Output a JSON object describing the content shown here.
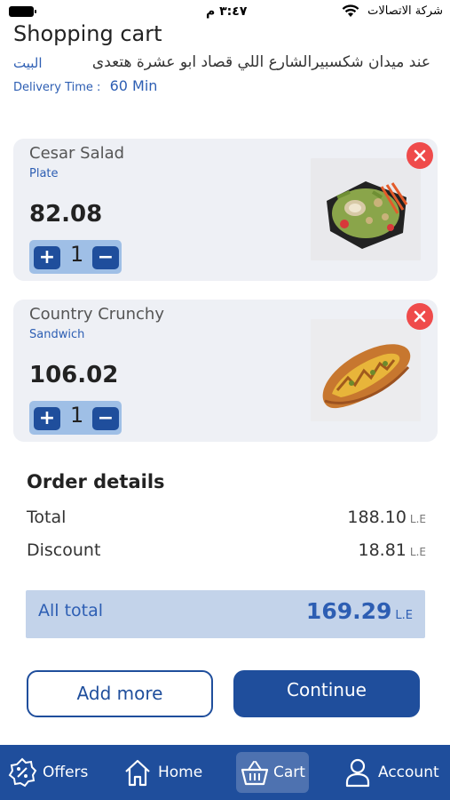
{
  "status_bar": {
    "time": "٣:٤٧ م",
    "carrier": "شركة الاتصالات"
  },
  "header": {
    "title": "Shopping cart",
    "address_label": "البيت",
    "address": "عند ميدان شكسبيرالشارع اللي قصاد ابو عشرة هتعدى",
    "delivery_label": "Delivery Time :",
    "delivery_value": "60 Min"
  },
  "cart": {
    "items": [
      {
        "name": "Cesar Salad",
        "category": "Plate",
        "price": "82.08",
        "quantity": "1",
        "thumb": "salad"
      },
      {
        "name": "Country Crunchy",
        "category": "Sandwich",
        "price": "106.02",
        "quantity": "1",
        "thumb": "sandwich"
      }
    ],
    "plus_symbol": "+",
    "minus_symbol": "−"
  },
  "order_details": {
    "title": "Order details",
    "total_label": "Total",
    "total_value": "188.10",
    "discount_label": "Discount",
    "discount_value": "18.81",
    "currency": "L.E",
    "all_total_label": "All total",
    "all_total_value": "169.29"
  },
  "actions": {
    "add_more": "Add more",
    "continue": "Continue"
  },
  "tab_bar": {
    "offers": "Offers",
    "home": "Home",
    "cart": "Cart",
    "account": "Account",
    "active": "cart"
  },
  "colors": {
    "primary": "#1f4e9c",
    "accent": "#2d5eb3",
    "remove": "#ef4b4b",
    "card": "#eef0f5",
    "total_bg": "#c3d3ea"
  }
}
